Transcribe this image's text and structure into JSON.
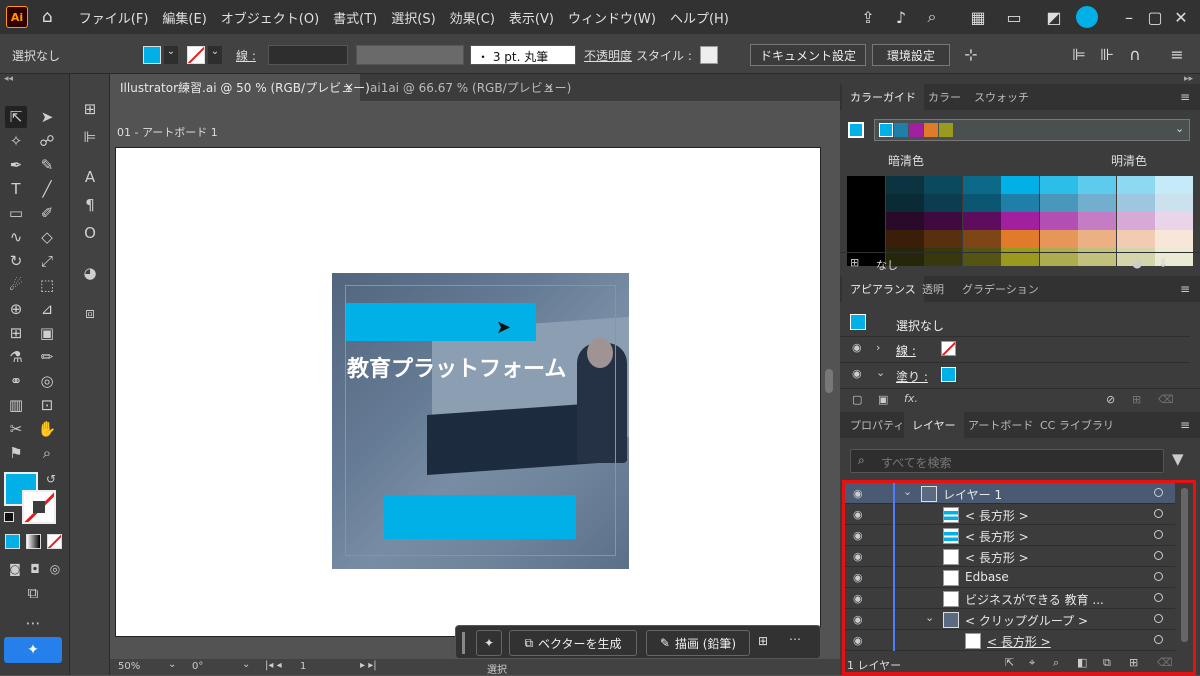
{
  "app": {
    "logo": "Ai"
  },
  "menu": [
    "ファイル(F)",
    "編集(E)",
    "オブジェクト(O)",
    "書式(T)",
    "選択(S)",
    "効果(C)",
    "表示(V)",
    "ウィンドウ(W)",
    "ヘルプ(H)"
  ],
  "control": {
    "selection": "選択なし",
    "stroke_label": "線 :",
    "brush": "・ 3 pt. 丸筆",
    "opacity_label": "不透明度",
    "style_label": "スタイル :",
    "doc_settings": "ドキュメント設定",
    "prefs": "環境設定"
  },
  "tabs": [
    {
      "label": "Illustrator練習.ai @ 50 % (RGB/プレビュー)",
      "active": true
    },
    {
      "label": "ai1ai @ 66.67 % (RGB/プレビュー)",
      "active": false
    }
  ],
  "artboard_label": "01 - アートボード 1",
  "canvas": {
    "headline": "教育プラットフォーム",
    "accent": "#00b0e6"
  },
  "floating_toolbar": {
    "vectorize": "ベクターを生成",
    "draw": "描画 (鉛筆)"
  },
  "status": {
    "zoom": "50%",
    "rotation": "0°",
    "page": "1",
    "mode": "選択"
  },
  "color_guide": {
    "tabs": [
      "カラーガイド",
      "カラー",
      "スウォッチ"
    ],
    "dark_label": "暗清色",
    "light_label": "明清色",
    "harmony": [
      "#00b0e6",
      "#1f7fa8",
      "#a020a0",
      "#e07b2a",
      "#9a9a1e"
    ],
    "grid": [
      [
        "#000000",
        "#0b3340",
        "#0b4a5e",
        "#0a6a87",
        "#00b0e6",
        "#2bbee8",
        "#5ccbee",
        "#8ed9f2",
        "#c5ebf8"
      ],
      [
        "#000000",
        "#0a2a36",
        "#0b3c4f",
        "#0a5673",
        "#1f7fa8",
        "#4997bb",
        "#72aecd",
        "#9cc7de",
        "#cbe1ee"
      ],
      [
        "#000000",
        "#2a0a2a",
        "#3f0a3f",
        "#5e0c5e",
        "#a020a0",
        "#b24fb2",
        "#c47cc4",
        "#d7a9d7",
        "#ead4ea"
      ],
      [
        "#000000",
        "#3a1e0a",
        "#56300f",
        "#7e4516",
        "#e07b2a",
        "#e59658",
        "#ebb185",
        "#f1cbb2",
        "#f8e6d9"
      ],
      [
        "#000000",
        "#26260a",
        "#38380d",
        "#545413",
        "#9a9a1e",
        "#adad4f",
        "#c1c17d",
        "#d5d5ab",
        "#eaead5"
      ]
    ],
    "none_label": "なし"
  },
  "appearance": {
    "tabs": [
      "アピアランス",
      "透明",
      "グラデーション"
    ],
    "title": "選択なし",
    "stroke": "線 :",
    "fill": "塗り :"
  },
  "layers_panel": {
    "tabs": [
      "プロパティ",
      "レイヤー",
      "アートボード",
      "CC ライブラリ"
    ],
    "search_placeholder": "すべてを検索",
    "footer": "1 レイヤー",
    "rows": [
      {
        "label": "レイヤー 1",
        "indent": 0,
        "expander": "⌄",
        "type": "layer"
      },
      {
        "label": "< 長方形 >",
        "indent": 1,
        "expander": "",
        "type": "rect-blue"
      },
      {
        "label": "< 長方形 >",
        "indent": 1,
        "expander": "",
        "type": "rect-blue"
      },
      {
        "label": "< 長方形 >",
        "indent": 1,
        "expander": "",
        "type": "rect"
      },
      {
        "label": "Edbase",
        "indent": 1,
        "expander": "",
        "type": "rect"
      },
      {
        "label": "ビジネスができる 教育 ...",
        "indent": 1,
        "expander": "",
        "type": "rect"
      },
      {
        "label": "< クリップグループ >",
        "indent": 1,
        "expander": "⌄",
        "type": "group"
      },
      {
        "label": "< 長方形 >",
        "indent": 2,
        "expander": "",
        "type": "rect-white"
      }
    ]
  }
}
